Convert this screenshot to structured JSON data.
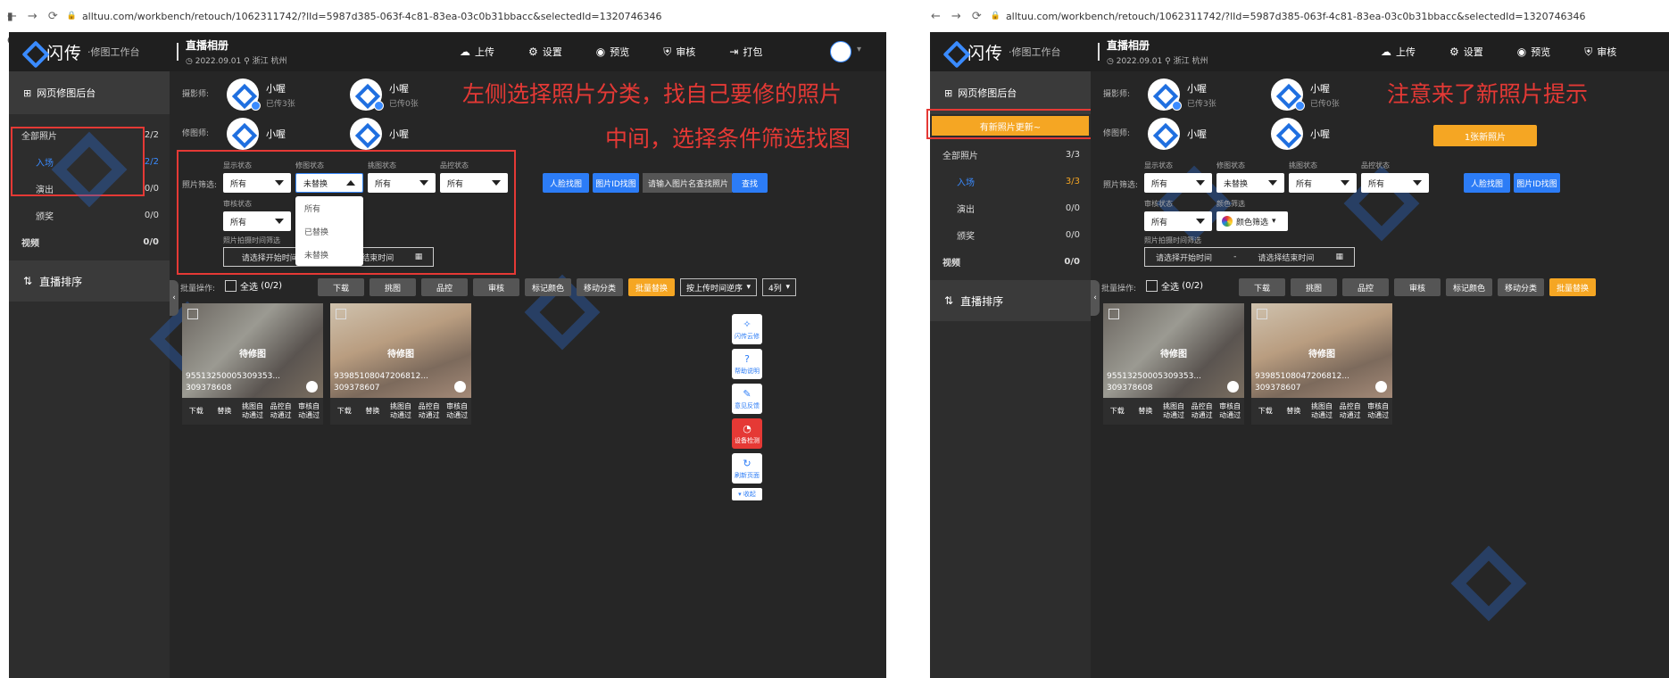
{
  "browser": {
    "url": "alltuu.com/workbench/retouch/1062311742/?lId=5987d385-063f-4c81-83ea-03c0b31bbacc&selectedId=1320746346"
  },
  "app": {
    "logo": "闪传",
    "logo_sub": "·修图工作台",
    "album_title": "直播相册",
    "album_date": "2022.09.01",
    "album_location": "浙江 杭州"
  },
  "topnav": {
    "upload": "上传",
    "settings": "设置",
    "preview": "预览",
    "review": "审核",
    "pack": "打包"
  },
  "sidebar": {
    "header": "网页修图后台",
    "all_photos": "全部照片",
    "all_count_left": "2/2",
    "all_count_right": "3/3",
    "items": [
      {
        "label": "入场",
        "count_left": "2/2",
        "count_right": "3/3"
      },
      {
        "label": "演出",
        "count": "0/0"
      },
      {
        "label": "颁奖",
        "count": "0/0"
      }
    ],
    "video": "视频",
    "video_count": "0/0",
    "rank": "直播排序",
    "new_update": "有新照片更新~"
  },
  "staff": {
    "photographer_label": "摄影师:",
    "retoucher_label": "修图师:",
    "name": "小喔",
    "uploaded_3": "已传3张",
    "uploaded_0": "已传0张"
  },
  "annotations": {
    "left1": "左侧选择照片分类，找自己要修的照片",
    "left2": "中间，选择条件筛选找图",
    "right1": "注意来了新照片提示"
  },
  "filters": {
    "label": "照片筛选:",
    "display_status": "显示状态",
    "retouch_status": "修图状态",
    "pick_status": "挑图状态",
    "qc_status": "品控状态",
    "review_status": "审核状态",
    "color_filter_label": "颜色筛选",
    "color_filter": "颜色筛选",
    "all": "所有",
    "not_replaced": "未替换",
    "replaced": "已替换",
    "time_label": "照片拍摄时间筛选",
    "start_time": "请选择开始时间",
    "end_time": "请选择结束时间",
    "date_sep": "-",
    "start_time_cut": "请选择开始时间",
    "end_time_cut": "结束时间",
    "face_search": "人脸找图",
    "id_search": "图片ID找图",
    "search_placeholder": "请输入图片名查找照片",
    "search_btn": "查找",
    "new_photos": "1张新照片"
  },
  "batch": {
    "label": "批量操作:",
    "select_all": "全选",
    "count": "(0/2)",
    "download": "下载",
    "pick": "挑图",
    "qc": "品控",
    "review": "审核",
    "mark_color": "标记颜色",
    "move": "移动分类",
    "batch_replace": "批量替换",
    "sort": "按上传时间逆序",
    "cols": "4列"
  },
  "photos": [
    {
      "state": "待修图",
      "name1": "95513250005309353...",
      "name2": "309378608"
    },
    {
      "state": "待修图",
      "name1": "93985108047206812...",
      "name2": "309378607"
    }
  ],
  "card_actions": {
    "download": "下载",
    "replace": "替换",
    "pick": "挑图自动通过",
    "qc": "品控自动通过",
    "review": "审核自动通过"
  },
  "tools": {
    "cloud": "闪传云修",
    "help": "帮助说明",
    "feedback": "意见反馈",
    "device": "设备检测",
    "refresh": "刷新页面",
    "collapse": "收起"
  }
}
